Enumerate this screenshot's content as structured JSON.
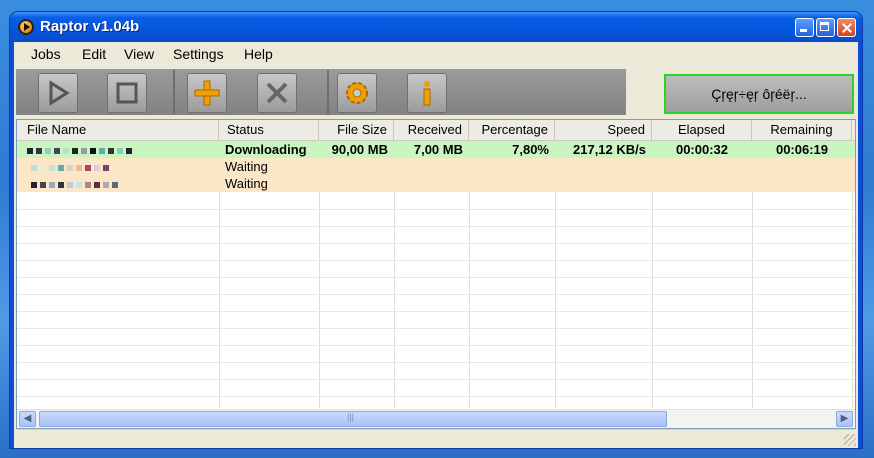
{
  "window": {
    "title": "Raptor v1.04b"
  },
  "menu": [
    "Jobs",
    "Edit",
    "View",
    "Settings",
    "Help"
  ],
  "toolbar": {
    "tools": [
      {
        "name": "play-icon"
      },
      {
        "name": "stop-icon"
      },
      {
        "name": "add-icon"
      },
      {
        "name": "remove-icon"
      },
      {
        "name": "settings-gear-icon"
      },
      {
        "name": "info-icon"
      }
    ],
    "language_button": "Çŗęŗ÷ęŗ ôŗéëŗ..."
  },
  "table": {
    "headers": [
      "File Name",
      "Status",
      "File Size",
      "Received",
      "Percentage",
      "Speed",
      "Elapsed",
      "Remaining"
    ],
    "rows": [
      {
        "status": "Downloading",
        "file_size": "90,00 MB",
        "received": "7,00 MB",
        "percentage": "7,80%",
        "speed": "217,12 KB/s",
        "elapsed": "00:00:32",
        "remaining": "00:06:19",
        "color": "#c8f5c0"
      },
      {
        "status": "Waiting",
        "file_size": "",
        "received": "",
        "percentage": "",
        "speed": "",
        "elapsed": "",
        "remaining": "",
        "color": "#fbe7c7"
      },
      {
        "status": "Waiting",
        "file_size": "",
        "received": "",
        "percentage": "",
        "speed": "",
        "elapsed": "",
        "remaining": "",
        "color": "#fbe7c7"
      }
    ]
  },
  "colors": {
    "titlebar": "#0a5ee6",
    "downloading_row": "#c8f5c0",
    "waiting_row": "#fbe7c7",
    "accent_green": "#2ad32a",
    "tool_icon_orange": "#f0a000"
  }
}
